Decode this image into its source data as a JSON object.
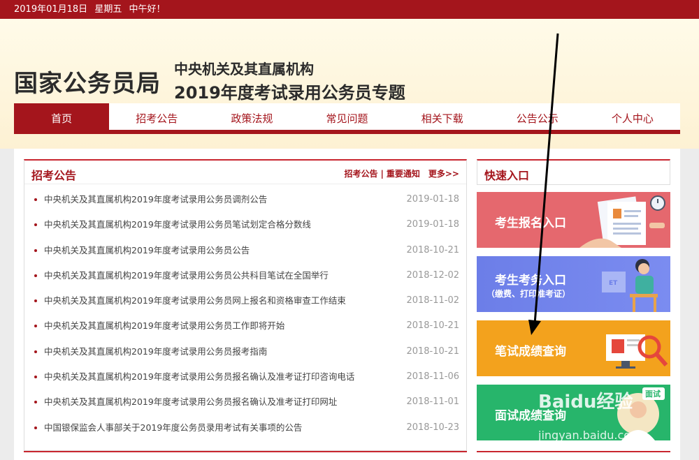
{
  "topbar": {
    "date": "2019年01月18日",
    "weekday": "星期五",
    "greeting": "中午好！"
  },
  "header": {
    "logo": "国家公务员局",
    "subtitle1": "中央机关及其直属机构",
    "subtitle2": "2019年度考试录用公务员专题"
  },
  "nav": {
    "items": [
      {
        "label": "首页"
      },
      {
        "label": "招考公告"
      },
      {
        "label": "政策法规"
      },
      {
        "label": "常见问题"
      },
      {
        "label": "相关下载"
      },
      {
        "label": "公告公示"
      },
      {
        "label": "个人中心"
      }
    ]
  },
  "announcements": {
    "title": "招考公告",
    "link1": "招考公告",
    "separator": "|",
    "link2": "重要通知",
    "more": "更多>>",
    "items": [
      {
        "title": "中央机关及其直属机构2019年度考试录用公务员调剂公告",
        "date": "2019-01-18"
      },
      {
        "title": "中央机关及其直属机构2019年度考试录用公务员笔试划定合格分数线",
        "date": "2019-01-18"
      },
      {
        "title": "中央机关及其直属机构2019年度考试录用公务员公告",
        "date": "2018-10-21"
      },
      {
        "title": "中央机关及其直属机构2019年度考试录用公务员公共科目笔试在全国举行",
        "date": "2018-12-02"
      },
      {
        "title": "中央机关及其直属机构2019年度考试录用公务员网上报名和资格审查工作结束",
        "date": "2018-11-02"
      },
      {
        "title": "中央机关及其直属机构2019年度考试录用公务员工作即将开始",
        "date": "2018-10-21"
      },
      {
        "title": "中央机关及其直属机构2019年度考试录用公务员报考指南",
        "date": "2018-10-21"
      },
      {
        "title": "中央机关及其直属机构2019年度考试录用公务员报名确认及准考证打印咨询电话",
        "date": "2018-11-06"
      },
      {
        "title": "中央机关及其直属机构2019年度考试录用公务员报名确认及准考证打印网址",
        "date": "2018-11-01"
      },
      {
        "title": "中国银保监会人事部关于2019年度公务员录用考试有关事项的公告",
        "date": "2018-10-23"
      }
    ]
  },
  "quick": {
    "title": "快速入口",
    "register": "考生报名入口",
    "exam_affairs": "考生考务入口",
    "exam_affairs_sub": "（缴费、打印准考证）",
    "written_score": "笔试成绩查询",
    "interview_score": "面试成绩查询",
    "interview_tag": "面试"
  },
  "watermark": {
    "main": "Baidu经验",
    "sub": "jingyan.baidu.com"
  },
  "colors": {
    "brand": "#a4151c",
    "q1": "#e5686e",
    "q2": "#6c7ee8",
    "q3": "#f3a21d",
    "q4": "#27b56b"
  }
}
